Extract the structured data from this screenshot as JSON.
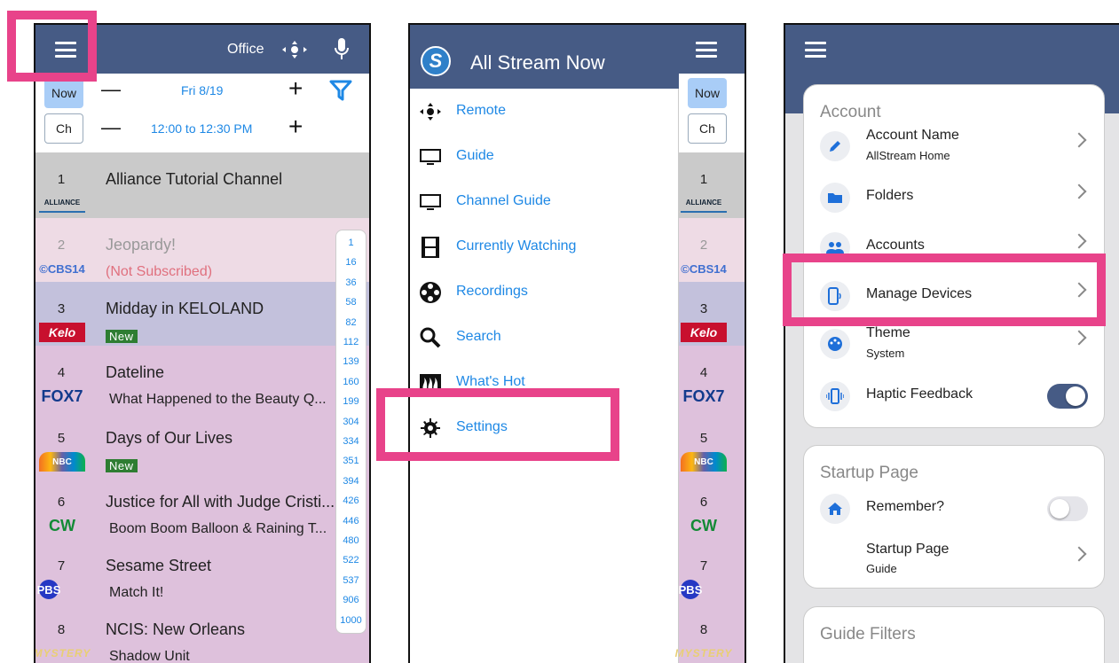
{
  "panel1": {
    "header": {
      "location": "Office"
    },
    "controls": {
      "now_label": "Now",
      "ch_label": "Ch",
      "minus": "—",
      "plus": "+",
      "date": "Fri 8/19",
      "time_range": "12:00 to 12:30 PM"
    },
    "rows": [
      {
        "num": "1",
        "logo": "ALLIANCE",
        "title": "Alliance Tutorial Channel",
        "sub": "",
        "bg": "#cacaca"
      },
      {
        "num": "2",
        "logo": "©CBS14",
        "title": "Jeopardy!",
        "sub": "(Not Subscribed)",
        "bg": "#eedbe5"
      },
      {
        "num": "3",
        "logo": "Kelo",
        "title": "Midday in KELOLAND",
        "badge": "New",
        "bg": "#c3c1dc"
      },
      {
        "num": "4",
        "logo": "FOX7",
        "title": "Dateline",
        "sub": "What Happened to the Beauty Q...",
        "bg": "#dec1dc"
      },
      {
        "num": "5",
        "logo": "NBC",
        "title": "Days of Our Lives",
        "badge": "New",
        "bg": "#dec1dc"
      },
      {
        "num": "6",
        "logo": "CW",
        "title": "Justice for All with Judge Cristi...",
        "sub": "Boom Boom Balloon & Raining T...",
        "bg": "#dec1dc"
      },
      {
        "num": "7",
        "logo": "PBS",
        "title": "Sesame Street",
        "sub": "Match It!",
        "bg": "#dec1dc"
      },
      {
        "num": "8",
        "logo": "MYSTERY",
        "title": "NCIS: New Orleans",
        "sub": "Shadow Unit",
        "bg": "#dec1dc"
      }
    ],
    "channel_index": [
      "1",
      "16",
      "36",
      "58",
      "82",
      "112",
      "139",
      "160",
      "199",
      "304",
      "334",
      "351",
      "394",
      "426",
      "446",
      "480",
      "522",
      "537",
      "906",
      "1000"
    ]
  },
  "panel2": {
    "app_title": "All Stream Now",
    "menu": [
      {
        "label": "Remote",
        "icon": "remote-dpad-icon"
      },
      {
        "label": "Guide",
        "icon": "tv-icon"
      },
      {
        "label": "Channel Guide",
        "icon": "tv-icon"
      },
      {
        "label": "Currently Watching",
        "icon": "film-strip-icon"
      },
      {
        "label": "Recordings",
        "icon": "film-reel-icon"
      },
      {
        "label": "Search",
        "icon": "search-icon"
      },
      {
        "label": "What's Hot",
        "icon": "fire-icon"
      },
      {
        "label": "Settings",
        "icon": "gear-icon"
      }
    ],
    "behind": {
      "now": "Now",
      "ch": "Ch",
      "nums": [
        "1",
        "2",
        "3",
        "4",
        "5",
        "6",
        "7",
        "8"
      ],
      "logos": [
        "ALLIANCE",
        "©CBS14",
        "Kelo",
        "FOX7",
        "NBC",
        "CW",
        "PBS",
        "MYSTERY"
      ]
    }
  },
  "panel3": {
    "account_header": "Account",
    "account_items": [
      {
        "title": "Account Name",
        "sub": "AllStream Home",
        "icon": "pencil-icon"
      },
      {
        "title": "Folders",
        "sub": "",
        "icon": "folder-icon"
      },
      {
        "title": "Accounts",
        "sub": "",
        "icon": "people-icon"
      },
      {
        "title": "Manage Devices",
        "sub": "",
        "icon": "phone-device-icon"
      },
      {
        "title": "Theme",
        "sub": "System",
        "icon": "palette-icon"
      },
      {
        "title": "Haptic Feedback",
        "sub": "",
        "icon": "vibrate-icon",
        "toggle": true
      }
    ],
    "startup_header": "Startup Page",
    "startup_items": [
      {
        "title": "Remember?",
        "icon": "home-icon",
        "toggle": false
      },
      {
        "title": "Startup Page",
        "sub": "Guide"
      }
    ],
    "filters_header": "Guide Filters"
  },
  "colors": {
    "header": "#465b85",
    "accent": "#1e88e5",
    "highlight": "#e8438a"
  }
}
